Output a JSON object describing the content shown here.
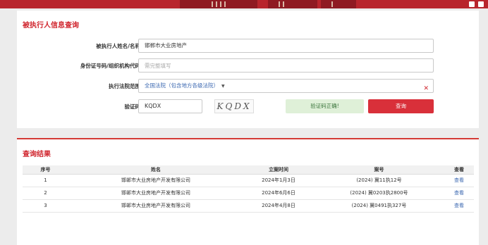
{
  "form": {
    "title": "被执行人信息查询",
    "name_label": "被执行人姓名/名称:",
    "name_value": "邯郸市大业房地产",
    "id_label": "身份证号码/组织机构代码:",
    "id_placeholder": "需完整填写",
    "court_label": "执行法院范围:",
    "court_value": "全国法院（包含地方各级法院）",
    "captcha_label": "验证码:",
    "captcha_value": "KQDX",
    "captcha_image_text": "KQDX",
    "captcha_status": "验证码正确!",
    "search_button": "查询"
  },
  "results": {
    "title": "查询结果",
    "headers": [
      "序号",
      "姓名",
      "立案时间",
      "案号",
      "查看"
    ],
    "rows": [
      {
        "index": "1",
        "name": "邯郸市大业房地产开发有限公司",
        "date": "2024年1月3日",
        "case": "(2024) 冀11执12号",
        "view": "查看"
      },
      {
        "index": "2",
        "name": "邯郸市大业房地产开发有限公司",
        "date": "2024年6月6日",
        "case": "(2024) 冀0203执2800号",
        "view": "查看"
      },
      {
        "index": "3",
        "name": "邯郸市大业房地产开发有限公司",
        "date": "2024年4月8日",
        "case": "(2024) 冀0491执327号",
        "view": "查看"
      }
    ]
  },
  "colors": {
    "accent": "#d0262e",
    "link": "#3a67b0",
    "success_bg": "#dff0d8"
  }
}
